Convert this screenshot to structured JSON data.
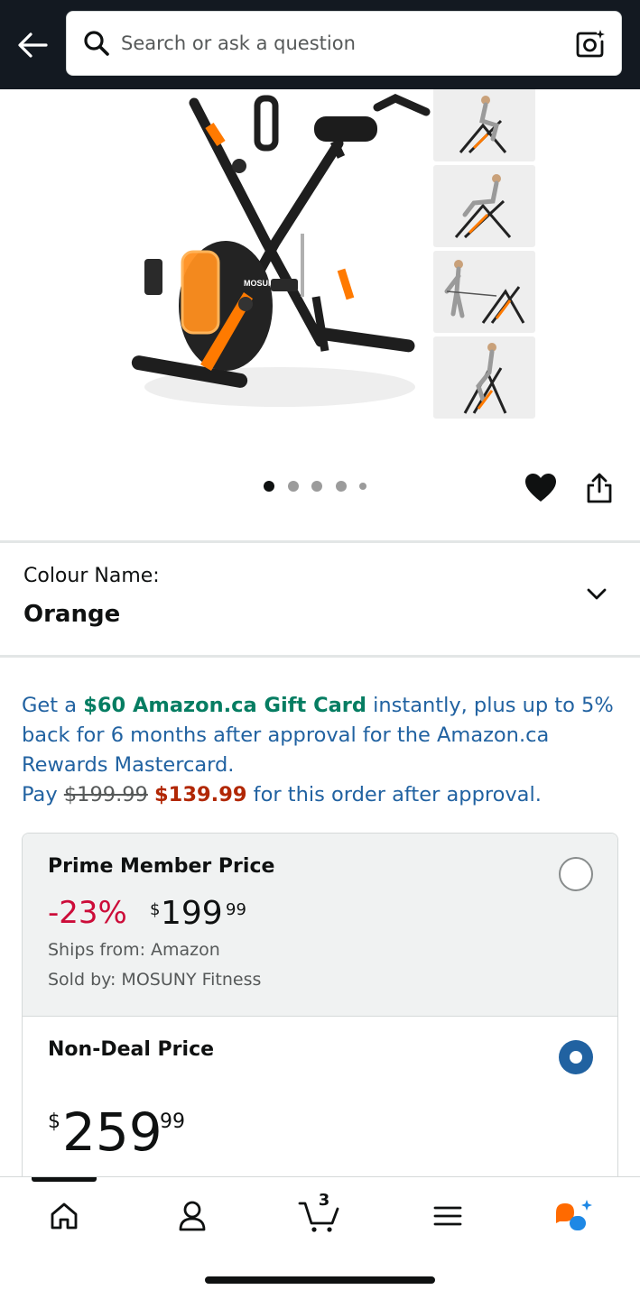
{
  "search": {
    "placeholder": "Search or ask a question"
  },
  "gallery": {
    "main_image_icon": "exercise-bike-image",
    "brand_on_bike": "MOSUNY",
    "thumbnails": [
      {
        "icon": "woman-cycling-thumbnail"
      },
      {
        "icon": "woman-reclined-thumbnail"
      },
      {
        "icon": "woman-band-exercise-thumbnail"
      },
      {
        "icon": "woman-seated-thumbnail"
      }
    ],
    "dot_count": 5,
    "active_dot": 0
  },
  "colour": {
    "label": "Colour Name:",
    "value": "Orange"
  },
  "promo": {
    "part1": "Get a ",
    "gift_card": "$60 Amazon.ca Gift Card",
    "part2": " instantly, plus up to 5% back for 6 months after approval for the Amazon.ca Rewards Mastercard.",
    "pay_label": "Pay ",
    "old_price": "$199.99",
    "new_price": "$139.99",
    "part3": " for this order after approval."
  },
  "prime_option": {
    "title": "Prime Member Price",
    "discount": "-23%",
    "currency": "$",
    "price_whole": "199",
    "price_fraction": "99",
    "ships_from": "Ships from: Amazon",
    "sold_by": "Sold by: MOSUNY Fitness",
    "selected": false
  },
  "nondeal_option": {
    "title": "Non-Deal Price",
    "currency": "$",
    "price_whole": "259",
    "price_fraction": "99",
    "selected": true
  },
  "nav": {
    "cart_count": "3",
    "items": [
      {
        "icon": "home-icon"
      },
      {
        "icon": "account-icon"
      },
      {
        "icon": "cart-icon"
      },
      {
        "icon": "menu-icon"
      },
      {
        "icon": "rufus-ai-icon"
      }
    ]
  },
  "colors": {
    "header_bg": "#131921",
    "link": "#2162a1",
    "green": "#067d62",
    "deal_red": "#cc0c39",
    "price_red": "#b12704",
    "rufus_orange": "#ff6a00",
    "rufus_blue": "#1e88e5"
  }
}
